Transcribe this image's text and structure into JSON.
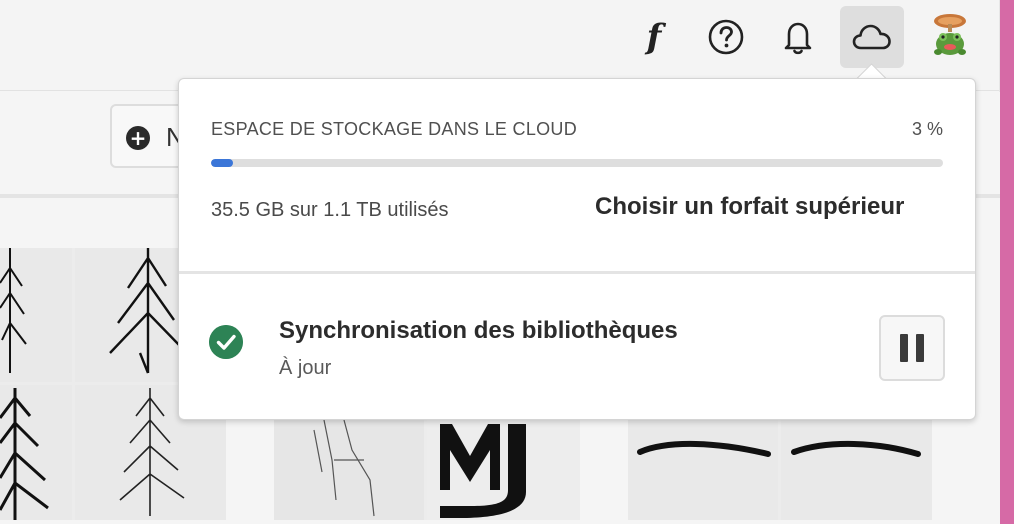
{
  "header": {
    "icons": [
      {
        "name": "fonts-icon",
        "glyph": "f"
      },
      {
        "name": "help-icon"
      },
      {
        "name": "bell-icon"
      },
      {
        "name": "cloud-icon",
        "active": true
      },
      {
        "name": "avatar"
      }
    ]
  },
  "toolbar": {
    "new_label": "N"
  },
  "storage": {
    "title": "ESPACE DE STOCKAGE DANS LE CLOUD",
    "percent_label": "3 %",
    "percent_used": 0.03,
    "used_text": "35.5 GB sur 1.1 TB utilisés",
    "upgrade_label": "Choisir un forfait supérieur"
  },
  "sync": {
    "title": "Synchronisation des bibliothèques",
    "status": "À jour",
    "status_icon": "check-circle-icon",
    "pause_icon": "pause-icon"
  },
  "colors": {
    "accent_bar": "#3b76d8",
    "success": "#2d8355",
    "edge_strip": "#d66aa6"
  }
}
